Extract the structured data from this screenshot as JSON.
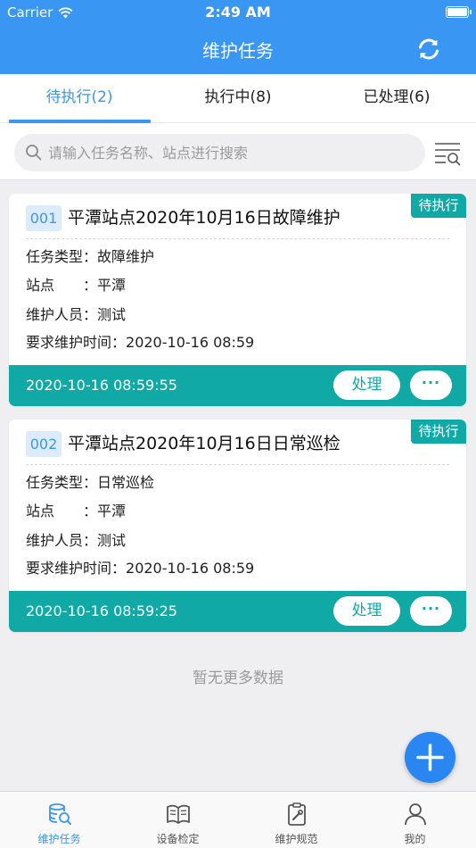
{
  "status_bar": {
    "carrier": "Carrier",
    "time": "2:49 AM"
  },
  "header": {
    "title": "维护任务",
    "refresh_icon": "refresh-icon"
  },
  "tabs": [
    {
      "label": "待执行(2)",
      "active": true
    },
    {
      "label": "执行中(8)",
      "active": false
    },
    {
      "label": "已处理(6)",
      "active": false
    }
  ],
  "search": {
    "placeholder": "请输入任务名称、站点进行搜索",
    "value": ""
  },
  "tasks": [
    {
      "number": "001",
      "title": "平潭站点2020年10月16日故障维护",
      "status": "待执行",
      "type_label": "任务类型：",
      "type": "故障维护",
      "site_label": "站点　　：",
      "site": "平潭",
      "person_label": "维护人员：",
      "person": "测试",
      "deadline_label": "要求维护时间：",
      "deadline": "2020-10-16 08:59",
      "timestamp": "2020-10-16 08:59:55",
      "action_label": "处理",
      "more_label": "···"
    },
    {
      "number": "002",
      "title": "平潭站点2020年10月16日日常巡检",
      "status": "待执行",
      "type_label": "任务类型：",
      "type": "日常巡检",
      "site_label": "站点　　：",
      "site": "平潭",
      "person_label": "维护人员：",
      "person": "测试",
      "deadline_label": "要求维护时间：",
      "deadline": "2020-10-16 08:59",
      "timestamp": "2020-10-16 08:59:25",
      "action_label": "处理",
      "more_label": "···"
    }
  ],
  "empty_text": "暂无更多数据",
  "bottom_nav": [
    {
      "label": "维护任务",
      "icon": "database-search-icon",
      "active": true
    },
    {
      "label": "设备检定",
      "icon": "open-book-icon",
      "active": false
    },
    {
      "label": "维护规范",
      "icon": "clipboard-wrench-icon",
      "active": false
    },
    {
      "label": "我的",
      "icon": "person-icon",
      "active": false
    }
  ],
  "colors": {
    "primary": "#3a96f3",
    "teal": "#10a9a5",
    "background": "#efeff1"
  }
}
